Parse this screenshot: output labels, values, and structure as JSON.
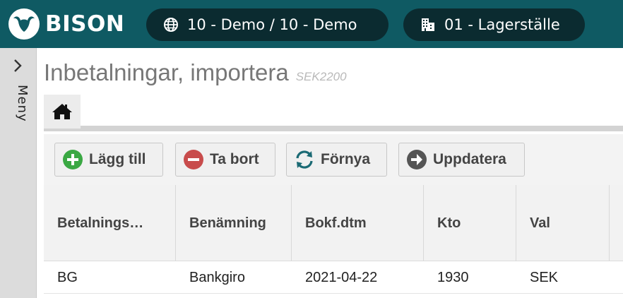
{
  "header": {
    "brand": "BISON",
    "company": "10 - Demo / 10 - Demo",
    "warehouse": "01 - Lagerställe",
    "colors": {
      "topbar": "#0f5a63",
      "pill": "#0b2b30"
    },
    "icons": {
      "company": "globe-icon",
      "warehouse": "building-icon",
      "logo": "bison-logo-icon"
    }
  },
  "sidebar": {
    "menu_label": "Meny",
    "icon": "chevron-right-icon"
  },
  "page": {
    "title": "Inbetalningar, importera",
    "code": "SEK2200"
  },
  "tabs": [
    {
      "icon": "home-icon",
      "active": true
    }
  ],
  "toolbar": {
    "add_label": "Lägg till",
    "delete_label": "Ta bort",
    "refresh_label": "Förnya",
    "update_label": "Uppdatera",
    "colors": {
      "add": "#3aa843",
      "delete": "#c84c4c",
      "refresh": "#1b6a74",
      "update": "#555555"
    }
  },
  "grid": {
    "columns": [
      "Betalnings…",
      "Benämning",
      "Bokf.dtm",
      "Kto",
      "Val",
      ""
    ],
    "rows": [
      [
        "BG",
        "Bankgiro",
        "2021-04-22",
        "1930",
        "SEK",
        ""
      ]
    ]
  }
}
